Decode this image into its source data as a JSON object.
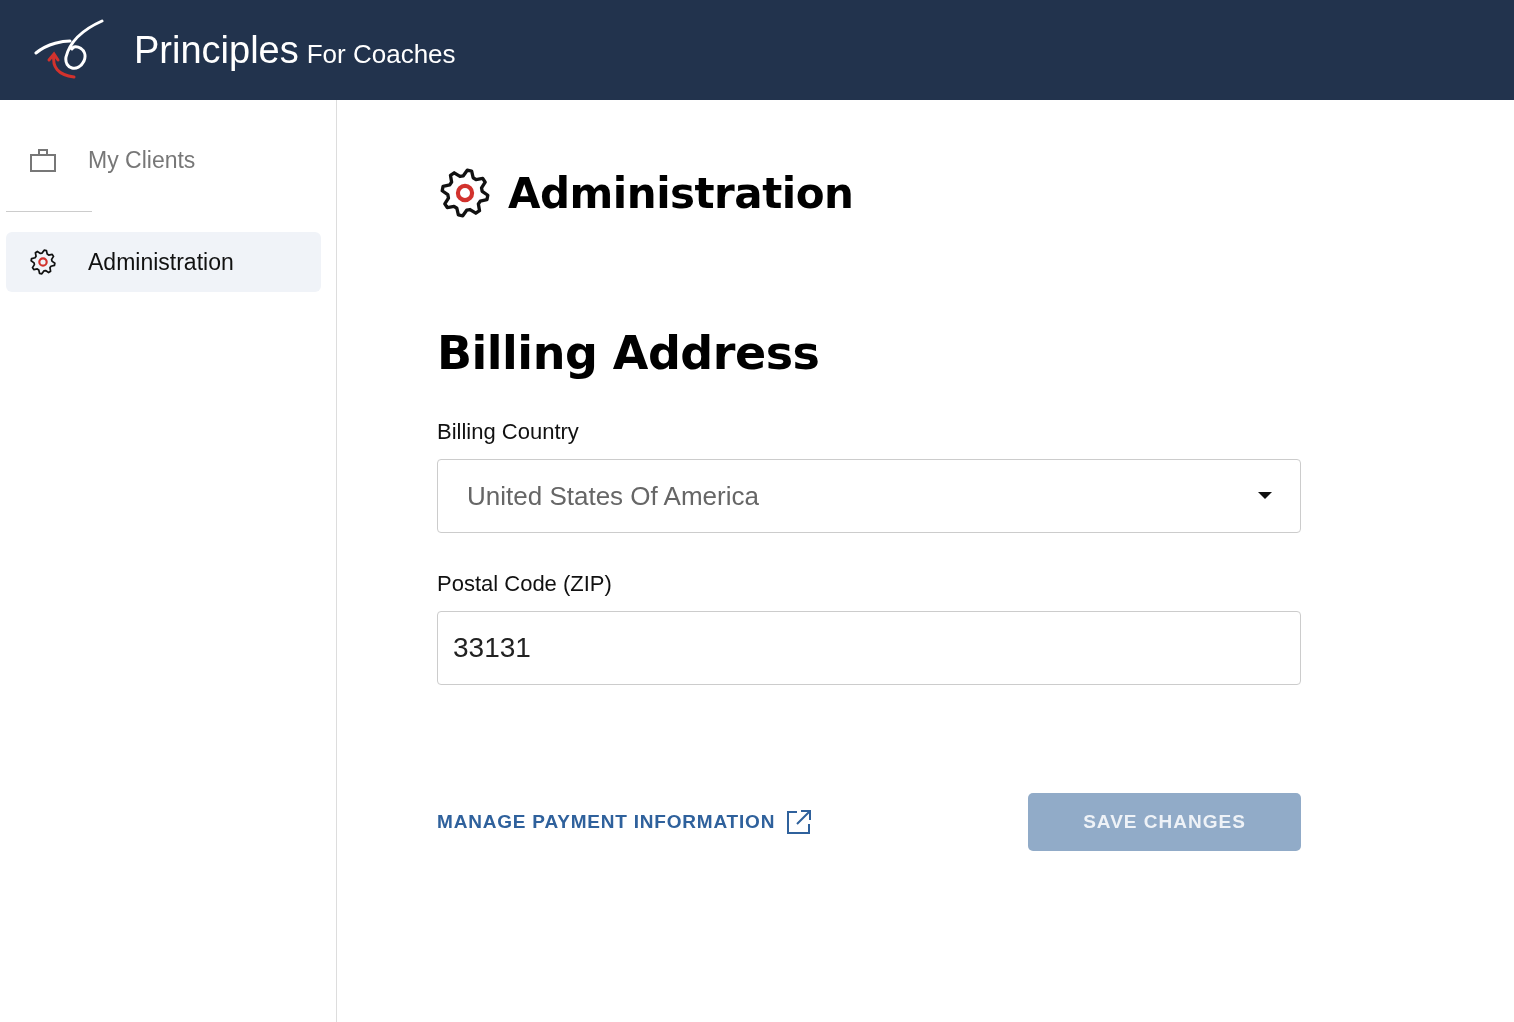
{
  "header": {
    "brand": "Principles",
    "tagline": "For Coaches"
  },
  "sidebar": {
    "items": [
      {
        "label": "My Clients",
        "kind": "briefcase",
        "selected": false
      },
      {
        "label": "Administration",
        "kind": "gear",
        "selected": true
      }
    ]
  },
  "page": {
    "title": "Administration"
  },
  "form": {
    "heading": "Billing Address",
    "fields": [
      {
        "kind": "select",
        "label": "Billing Country",
        "value": "United States Of America"
      },
      {
        "kind": "text",
        "label": "Postal Code (ZIP)",
        "value": "33131"
      }
    ],
    "link": "MANAGE PAYMENT INFORMATION",
    "save_button": {
      "label": "SAVE CHANGES",
      "disabled": true
    }
  }
}
